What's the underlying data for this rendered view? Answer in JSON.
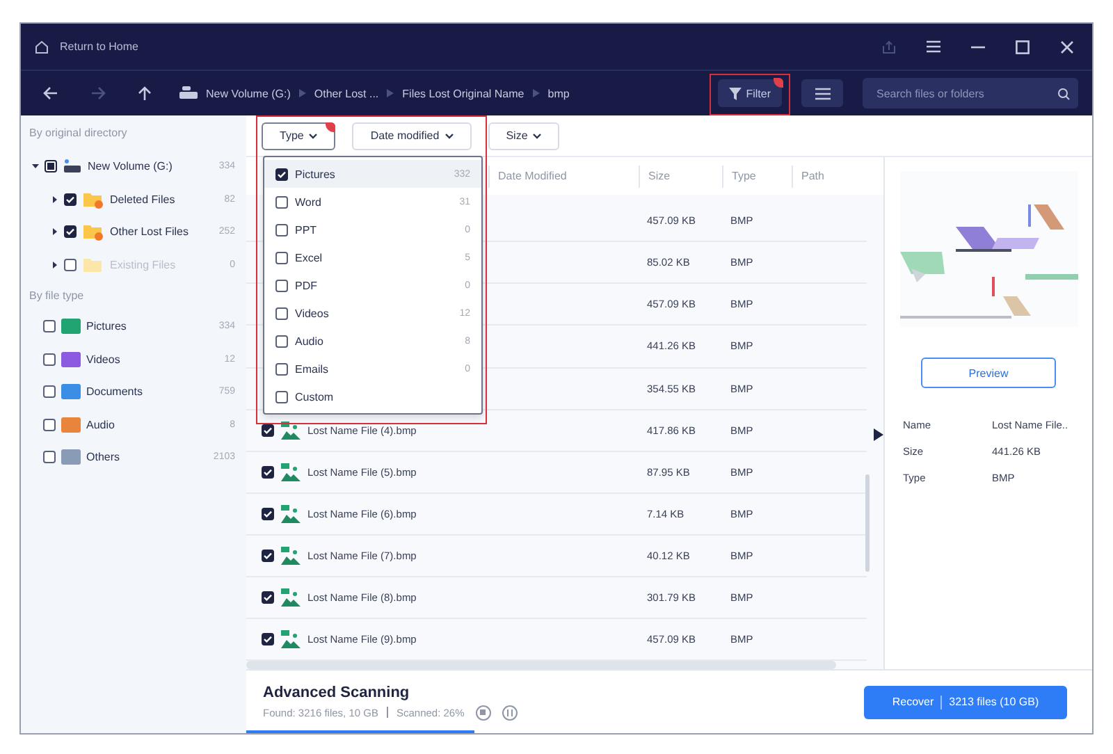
{
  "title_bar": {
    "home_label": "Return to Home"
  },
  "breadcrumb": [
    "New Volume (G:)",
    "Other Lost ...",
    "Files Lost Original Name",
    "bmp"
  ],
  "toolbar": {
    "filter_label": "Filter",
    "filter_active": true,
    "search_placeholder": "Search files or folders"
  },
  "sidebar": {
    "directory_heading": "By original directory",
    "tree": [
      {
        "label": "New Volume (G:)",
        "count": "334",
        "checked": false,
        "indeterminate": true,
        "expanded": true,
        "disabled": false,
        "kind": "drive",
        "children": [
          {
            "label": "Deleted Files",
            "count": "82",
            "checked": true,
            "expanded": false,
            "disabled": false,
            "kind": "folder"
          },
          {
            "label": "Other Lost Files",
            "count": "252",
            "checked": true,
            "expanded": false,
            "disabled": false,
            "kind": "folder"
          },
          {
            "label": "Existing Files",
            "count": "0",
            "checked": false,
            "expanded": false,
            "disabled": true,
            "kind": "plain-folder"
          }
        ]
      }
    ],
    "type_heading": "By file type",
    "types": [
      {
        "label": "Pictures",
        "count": "334",
        "checked": false,
        "color": "#22a372"
      },
      {
        "label": "Videos",
        "count": "12",
        "checked": false,
        "color": "#8c5ae0"
      },
      {
        "label": "Documents",
        "count": "759",
        "checked": false,
        "color": "#3a8ee6"
      },
      {
        "label": "Audio",
        "count": "8",
        "checked": false,
        "color": "#e8843c"
      },
      {
        "label": "Others",
        "count": "2103",
        "checked": false,
        "color": "#8a9bb8"
      }
    ]
  },
  "filters": [
    {
      "label": "Type",
      "open": true,
      "active": true
    },
    {
      "label": "Date modified",
      "open": false,
      "active": false
    },
    {
      "label": "Size",
      "open": false,
      "active": false
    }
  ],
  "type_menu": [
    {
      "label": "Pictures",
      "count": "332",
      "checked": true,
      "selected": true
    },
    {
      "label": "Word",
      "count": "31",
      "checked": false,
      "selected": false
    },
    {
      "label": "PPT",
      "count": "0",
      "checked": false,
      "selected": false
    },
    {
      "label": "Excel",
      "count": "5",
      "checked": false,
      "selected": false
    },
    {
      "label": "PDF",
      "count": "0",
      "checked": false,
      "selected": false
    },
    {
      "label": "Videos",
      "count": "12",
      "checked": false,
      "selected": false
    },
    {
      "label": "Audio",
      "count": "8",
      "checked": false,
      "selected": false
    },
    {
      "label": "Emails",
      "count": "0",
      "checked": false,
      "selected": false
    },
    {
      "label": "Custom",
      "checked": false,
      "selected": false
    }
  ],
  "table": {
    "columns": [
      "Date Modified",
      "Size",
      "Type",
      "Path"
    ],
    "rows": [
      {
        "size": "457.09 KB",
        "type": "BMP"
      },
      {
        "size": "85.02 KB",
        "type": "BMP"
      },
      {
        "size": "457.09 KB",
        "type": "BMP"
      },
      {
        "size": "441.26 KB",
        "type": "BMP"
      },
      {
        "size": "354.55 KB",
        "type": "BMP"
      },
      {
        "name": "Lost Name File (4).bmp",
        "checked": true,
        "size": "417.86 KB",
        "type": "BMP"
      },
      {
        "name": "Lost Name File (5).bmp",
        "checked": true,
        "size": "87.95 KB",
        "type": "BMP"
      },
      {
        "name": "Lost Name File (6).bmp",
        "checked": true,
        "size": "7.14 KB",
        "type": "BMP"
      },
      {
        "name": "Lost Name File (7).bmp",
        "checked": true,
        "size": "40.12 KB",
        "type": "BMP"
      },
      {
        "name": "Lost Name File (8).bmp",
        "checked": true,
        "size": "301.79 KB",
        "type": "BMP"
      },
      {
        "name": "Lost Name File (9).bmp",
        "checked": true,
        "size": "457.09 KB",
        "type": "BMP"
      }
    ]
  },
  "details": {
    "preview_button": "Preview",
    "fields": [
      {
        "label": "Name",
        "value": "Lost Name File.."
      },
      {
        "label": "Size",
        "value": "441.26 KB"
      },
      {
        "label": "Type",
        "value": "BMP"
      }
    ]
  },
  "status": {
    "title": "Advanced Scanning",
    "found": "Found: 3216 files, 10 GB",
    "scanned": "Scanned: 26%",
    "level": 0.27
  },
  "recover": {
    "label": "Recover",
    "files": "3213 files (10 GB)"
  }
}
